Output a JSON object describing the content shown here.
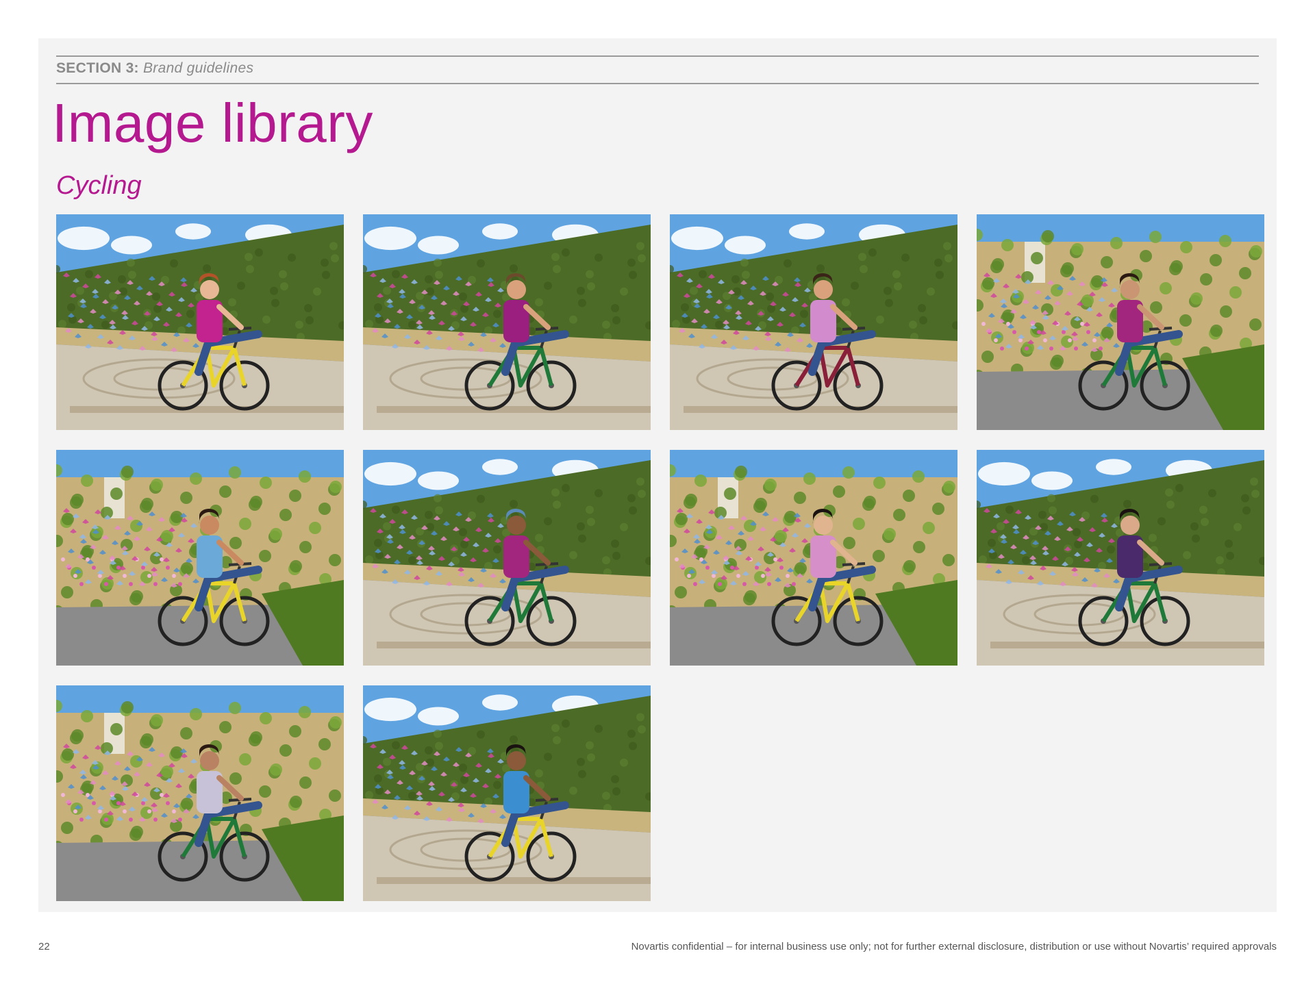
{
  "header": {
    "section_number": "SECTION 3:",
    "section_name": "Brand guidelines"
  },
  "title": "Image library",
  "subtitle": "Cycling",
  "colors": {
    "brand_magenta": "#b5198f",
    "rule_gray": "#9a9a9a",
    "panel_bg": "#f3f3f3"
  },
  "photos": [
    {
      "name": "cyclist-photo-1",
      "scene": "hedge",
      "shirt": "#c2238f",
      "bike": "#e9d52a",
      "skin": "#e8b896",
      "hair": "#b4532a"
    },
    {
      "name": "cyclist-photo-2",
      "scene": "hedge",
      "shirt": "#9a1f7e",
      "bike": "#1f7a3a",
      "skin": "#d9a27c",
      "hair": "#6b4b2b"
    },
    {
      "name": "cyclist-photo-3",
      "scene": "hedge",
      "shirt": "#d28bcd",
      "bike": "#8a1f3a",
      "skin": "#d9a27c",
      "hair": "#3a2418"
    },
    {
      "name": "cyclist-photo-4",
      "scene": "stone-wall",
      "shirt": "#a3267e",
      "bike": "#1f7a3a",
      "skin": "#c99572",
      "hair": "#2a1a12"
    },
    {
      "name": "cyclist-photo-5",
      "scene": "stone-wall",
      "shirt": "#6aa9d8",
      "bike": "#e9d52a",
      "skin": "#c98a62",
      "hair": "#2a1a12"
    },
    {
      "name": "cyclist-photo-6",
      "scene": "hedge",
      "shirt": "#a3267e",
      "bike": "#1f7a3a",
      "skin": "#8a5a3a",
      "hair": "#5a8ab8"
    },
    {
      "name": "cyclist-photo-7",
      "scene": "stone-wall",
      "shirt": "#d68fc9",
      "bike": "#e9d52a",
      "skin": "#e0b48e",
      "hair": "#1a1210"
    },
    {
      "name": "cyclist-photo-8",
      "scene": "hedge",
      "shirt": "#4a2a6a",
      "bike": "#1f7a3a",
      "skin": "#d9a98a",
      "hair": "#1a1210"
    },
    {
      "name": "cyclist-photo-9",
      "scene": "stone-wall",
      "shirt": "#c7c2d8",
      "bike": "#1f7a3a",
      "skin": "#b98262",
      "hair": "#2a1a12"
    },
    {
      "name": "cyclist-photo-10",
      "scene": "hedge",
      "shirt": "#3b8fd0",
      "bike": "#e9d52a",
      "skin": "#8a5a3a",
      "hair": "#1a1210"
    }
  ],
  "footer": {
    "page_number": "22",
    "confidential_note": "Novartis confidential – for internal business use only; not for further external disclosure, distribution or use without Novartis’ required approvals"
  }
}
